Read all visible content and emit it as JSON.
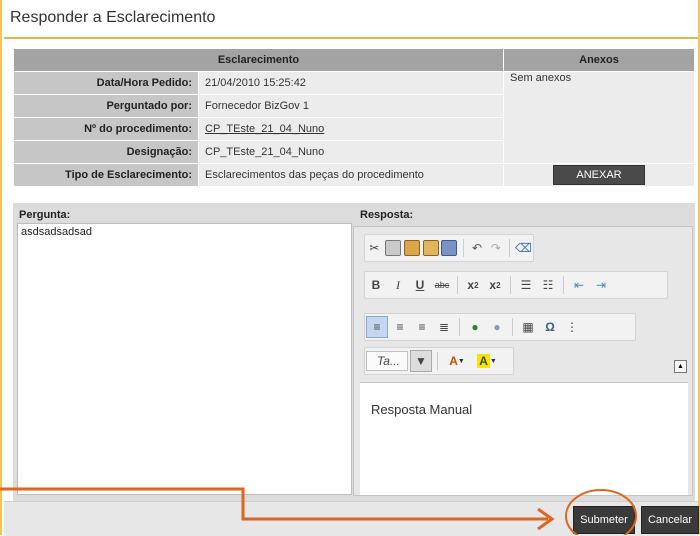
{
  "window": {
    "title": "Responder a Esclarecimento"
  },
  "info": {
    "section_header": "Esclarecimento",
    "attachments_header": "Anexos",
    "rows": [
      {
        "label": "Data/Hora Pedido:",
        "value": "21/04/2010 15:25:42"
      },
      {
        "label": "Perguntado por:",
        "value": "Fornecedor BizGov 1"
      },
      {
        "label": "Nº do procedimento:",
        "value": "CP_TEste_21_04_Nuno"
      },
      {
        "label": "Designação:",
        "value": "CP_TEste_21_04_Nuno"
      },
      {
        "label": "Tipo de Esclarecimento:",
        "value": "Esclarecimentos das peças do procedimento"
      }
    ],
    "no_attachments": "Sem anexos",
    "attach_button": "ANEXAR"
  },
  "question": {
    "label": "Pergunta:",
    "text": "asdsadsadsad"
  },
  "response": {
    "label": "Resposta:",
    "style_placeholder": "Ta...",
    "text": "Resposta Manual"
  },
  "toolbar_icons": [
    "cut-icon",
    "copy-icon",
    "paste-icon",
    "paste-text-icon",
    "paste-word-icon",
    "undo-icon",
    "redo-icon",
    "eraser-icon",
    "bold-icon",
    "italic-icon",
    "underline-icon",
    "strikethrough-icon",
    "subscript-icon",
    "superscript-icon",
    "numbered-list-icon",
    "bullet-list-icon",
    "outdent-icon",
    "indent-icon",
    "align-left-icon",
    "align-center-icon",
    "align-right-icon",
    "justify-icon",
    "link-icon",
    "unlink-icon",
    "table-icon",
    "special-char-icon",
    "page-break-icon",
    "text-color-icon",
    "bg-color-icon"
  ],
  "footer": {
    "submit": "Submeter",
    "cancel": "Cancelar"
  },
  "colors": {
    "accent_border": "#f5c35a",
    "annotation": "#e0661c",
    "button_dark": "#3a3a3a"
  }
}
